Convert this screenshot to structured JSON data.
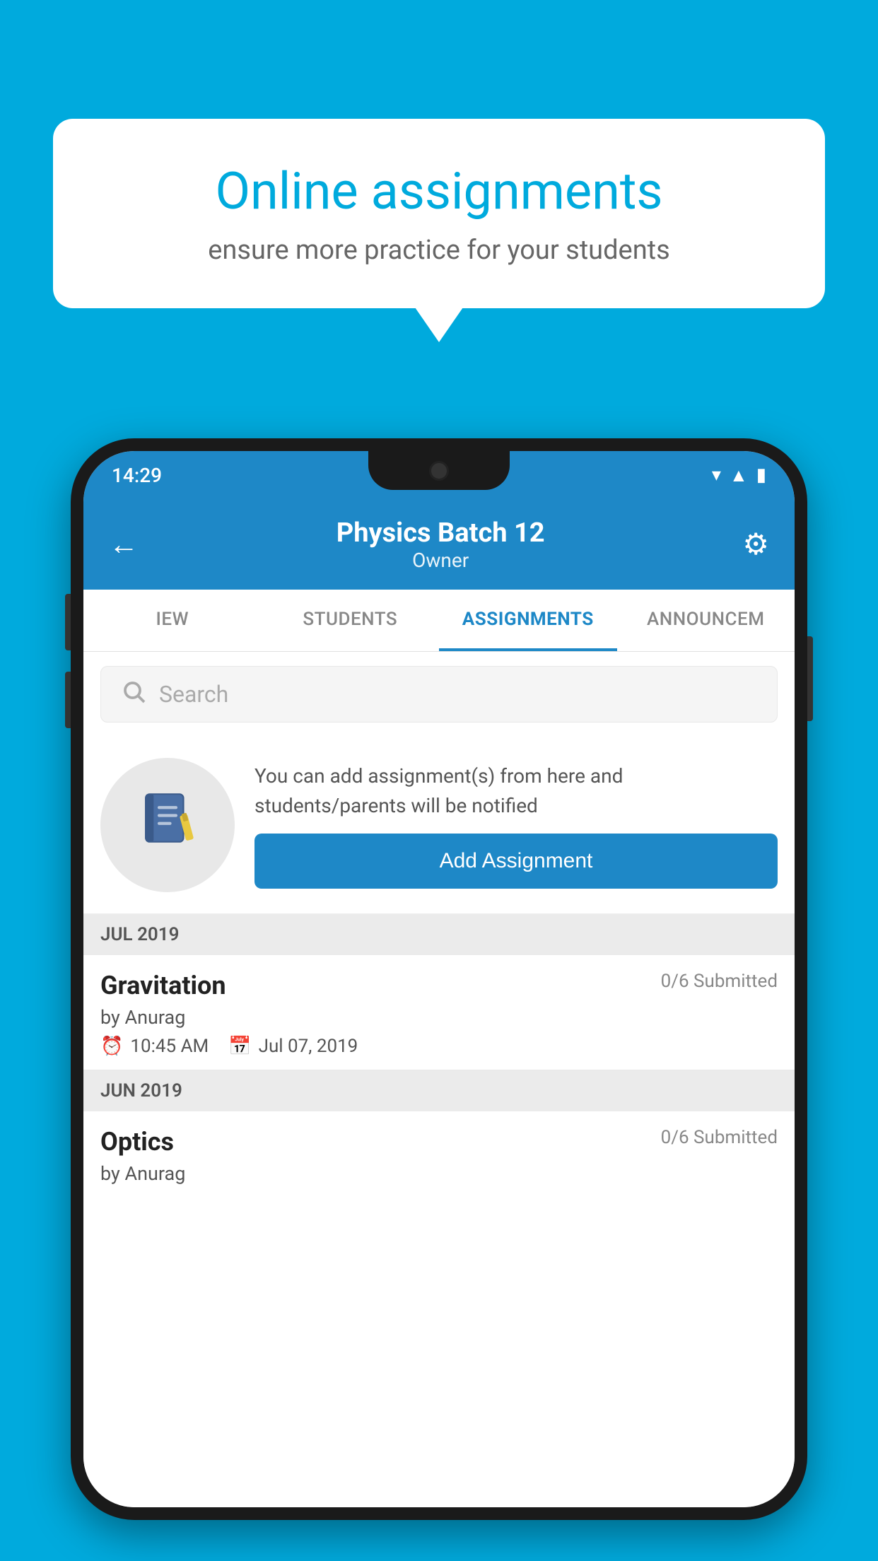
{
  "background_color": "#00AADD",
  "speech_bubble": {
    "title": "Online assignments",
    "subtitle": "ensure more practice for your students"
  },
  "status_bar": {
    "time": "14:29",
    "icons": [
      "wifi",
      "signal",
      "battery"
    ]
  },
  "header": {
    "title": "Physics Batch 12",
    "subtitle": "Owner",
    "back_label": "←",
    "gear_label": "⚙"
  },
  "tabs": [
    {
      "label": "IEW",
      "active": false
    },
    {
      "label": "STUDENTS",
      "active": false
    },
    {
      "label": "ASSIGNMENTS",
      "active": true
    },
    {
      "label": "ANNOUNCEM",
      "active": false
    }
  ],
  "search": {
    "placeholder": "Search"
  },
  "promo": {
    "text": "You can add assignment(s) from here and students/parents will be notified",
    "button_label": "Add Assignment"
  },
  "sections": [
    {
      "label": "JUL 2019",
      "assignments": [
        {
          "name": "Gravitation",
          "submitted": "0/6 Submitted",
          "by": "by Anurag",
          "time": "10:45 AM",
          "date": "Jul 07, 2019"
        }
      ]
    },
    {
      "label": "JUN 2019",
      "assignments": [
        {
          "name": "Optics",
          "submitted": "0/6 Submitted",
          "by": "by Anurag",
          "time": "",
          "date": ""
        }
      ]
    }
  ]
}
